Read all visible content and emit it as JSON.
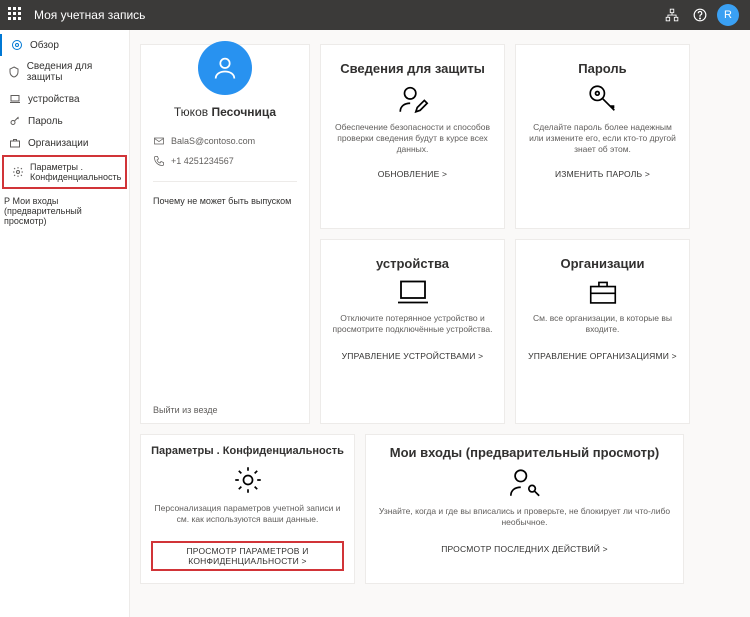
{
  "topbar": {
    "title": "Моя учетная запись",
    "avatar_initial": "R"
  },
  "sidebar": {
    "items": [
      {
        "label": "Обзор"
      },
      {
        "label": "Сведения для защиты"
      },
      {
        "label": "устройства"
      },
      {
        "label": "Пароль"
      },
      {
        "label": "Организации"
      },
      {
        "label": "Параметры . Конфиденциальность"
      }
    ],
    "footnote": "Р Мои входы (предварительный просмотр)"
  },
  "profile": {
    "name_prefix": "Тюков",
    "name_main": "Песочница",
    "email": "BalaS@contoso.com",
    "phone": "+1 4251234567",
    "why": "Почему не может быть выпуском",
    "signout": "Выйти из везде"
  },
  "cards": {
    "security": {
      "title": "Сведения для защиты",
      "desc": "Обеспечение безопасности и способов проверки сведения будут в курсе всех данных.",
      "action": "ОБНОВЛЕНИЕ &gt;"
    },
    "password": {
      "title": "Пароль",
      "desc": "Сделайте пароль более надежным или измените его, если кто-то другой знает об этом.",
      "action": "ИЗМЕНИТЬ ПАРОЛЬ &gt;"
    },
    "devices": {
      "title": "устройства",
      "desc": "Отключите потерянное устройство и просмотрите подключённые устройства.",
      "action": "УПРАВЛЕНИЕ УСТРОЙСТВАМИ &gt;"
    },
    "orgs": {
      "title": "Организации",
      "desc": "См. все организации, в которые вы входите.",
      "action": "УПРАВЛЕНИЕ ОРГАНИЗАЦИЯМИ &gt;"
    },
    "privacy": {
      "title": "Параметры . Конфиденциальность",
      "desc": "Персонализация параметров учетной записи и см. как используются ваши данные.",
      "action": "ПРОСМОТР ПАРАМЕТРОВ И КОНФИДЕНЦИАЛЬНОСТИ &gt;"
    },
    "signins": {
      "title": "Мои входы (предварительный просмотр)",
      "desc": "Узнайте, когда и где вы вписались и проверьте, не блокирует ли что-либо необычное.",
      "action": "ПРОСМОТР ПОСЛЕДНИХ ДЕЙСТВИЙ &gt;"
    }
  }
}
